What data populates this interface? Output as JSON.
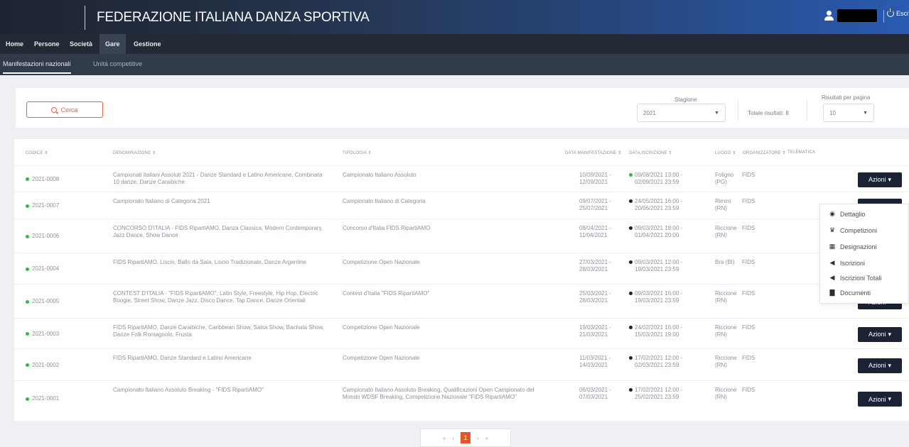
{
  "app": {
    "title": "FEDERAZIONE ITALIANA DANZA SPORTIVA",
    "exit_label": "Esci"
  },
  "nav": [
    "Home",
    "Persone",
    "Società",
    "Gare",
    "Gestione"
  ],
  "subnav": [
    "Manifestazioni nazionali",
    "Unità competitive"
  ],
  "filters": {
    "search_label": "Cerca",
    "season_label": "Stagione",
    "season_value": "2021",
    "total_label": "Totale risultati: 8",
    "per_page_label": "Risultati per pagina",
    "per_page_value": "10"
  },
  "columns": [
    "Codice",
    "Denominazione",
    "Tipologia",
    "Data manifestazione",
    "Data iscrizione",
    "Luogo",
    "Organizzatore",
    "Telematica"
  ],
  "rows": [
    {
      "code": "2021-0008",
      "name": "Campionati Italiani Assoluti 2021 - Danze Standard e Latino Americane, Combinata 10 danze, Danze Caraibiche",
      "type": "Campionato Italiano Assoluto",
      "dates": "10/09/2021 - 12/09/2021",
      "iscr": "09/08/2021 13:00 - 02/09/2021 23:59",
      "place": "Foligno (PG)",
      "org": "FIDS"
    },
    {
      "code": "2021-0007",
      "name": "Campionato Italiano di Categoria 2021",
      "type": "Campionato Italiano di Categoria",
      "dates": "09/07/2021 - 25/07/2021",
      "iscr": "24/05/2021 16:00 - 20/06/2021 23:59",
      "place": "Rimini (RN)",
      "org": "FIDS"
    },
    {
      "code": "2021-0006",
      "name": "CONCORSO D'ITALIA - FIDS RipartiAMO, Danza Classica, Modern Contemporary, Jazz Dance, Show Dance",
      "type": "Concorso d'Italia FIDS RipartiAMO",
      "dates": "08/04/2021 - 11/04/2021",
      "iscr": "09/03/2021 18:00 - 01/04/2021 20:00",
      "place": "Riccione (RN)",
      "org": "FIDS"
    },
    {
      "code": "2021-0004",
      "name": "FIDS RipartiAMO, Liscio, Ballo da Sala, Liscio Tradizionale, Danze Argentine",
      "type": "Competizione Open Nazionale",
      "dates": "27/03/2021 - 28/03/2021",
      "iscr": "09/03/2021 12:00 - 19/03/2021 23:59",
      "place": "Bra (BI)",
      "org": "FIDS"
    },
    {
      "code": "2021-0005",
      "name": "CONTEST D'ITALIA - \"FIDS RipartiAMO\", Latin Style, Freestyle, Hip Hop, Electric Boogie, Street Show, Danze Jazz, Disco Dance, Tap Dance, Danze Orientali",
      "type": "Contest d'Italia \"FIDS RipartiAMO\"",
      "dates": "25/03/2021 - 28/03/2021",
      "iscr": "09/03/2021 16:00 - 19/03/2021 23:59",
      "place": "Riccione (RN)",
      "org": "FIDS"
    },
    {
      "code": "2021-0003",
      "name": "FIDS RipartiAMO, Danze Caraibiche, Caribbean Show, Salsa Show, Bachata Show, Danze Folk Romagnolo, Frusta",
      "type": "Competizione Open Nazionale",
      "dates": "19/03/2021 - 21/03/2021",
      "iscr": "24/02/2021 16:00 - 15/03/2021 19:00",
      "place": "Riccione (RN)",
      "org": "FIDS"
    },
    {
      "code": "2021-0002",
      "name": "FIDS RipartiAMO, Danze Standard e Latino Americane",
      "type": "Competizione Open Nazionale",
      "dates": "11/03/2021 - 14/03/2021",
      "iscr": "17/02/2021 12:00 - 02/03/2021 23:59",
      "place": "Riccione (RN)",
      "org": "FIDS"
    },
    {
      "code": "2021-0001",
      "name": "Campionato Italiano Assoluto Breaking - \"FIDS RipartiAMO\"",
      "type": "Campionato Italiano Assoluto Breaking, Qualificazioni Open Campionato del Mondo WDSF Breaking, Competizione Nazionale \"FIDS RipartiAMO\"",
      "dates": "06/03/2021 - 07/03/2021",
      "iscr": "17/02/2021 12:00 - 25/02/2021 23:59",
      "place": "Riccione (RN)",
      "org": "FIDS"
    }
  ],
  "azioni_label": "Azioni",
  "dropdown": [
    "Dettaglio",
    "Competizioni",
    "Designazioni",
    "Iscrizioni",
    "Iscrizioni Totali",
    "Documenti"
  ],
  "pagination": {
    "first": "«",
    "prev": "‹",
    "current": "1",
    "next": "›",
    "last": "»"
  }
}
